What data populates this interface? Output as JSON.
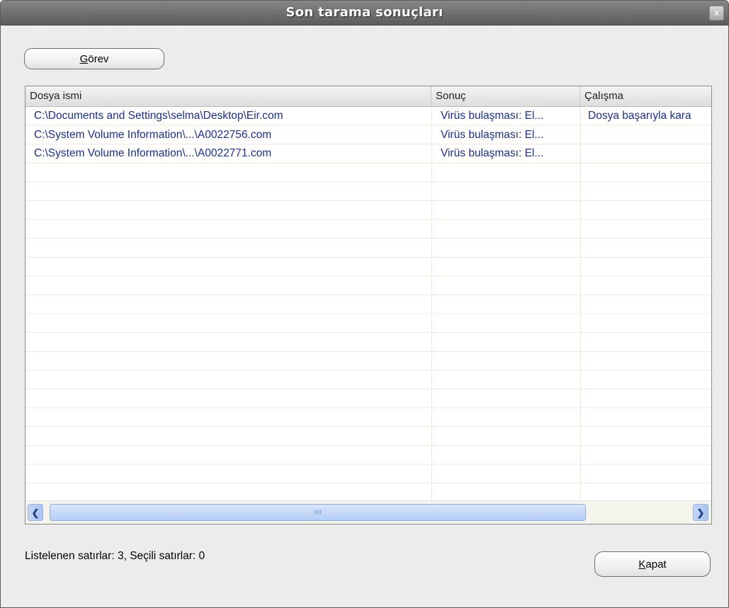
{
  "window": {
    "title": "Son tarama sonuçları",
    "close_icon": "close-icon"
  },
  "toolbar": {
    "task_label_first": "G",
    "task_label_rest": "örev"
  },
  "table": {
    "columns": [
      "Dosya ismi",
      "Sonuç",
      "Çalışma"
    ],
    "rows": [
      {
        "file": "C:\\Documents and Settings\\selma\\Desktop\\Eir.com",
        "result": "Virüs bulaşması: El...",
        "action": "Dosya başarıyla kara"
      },
      {
        "file": "C:\\System Volume Information\\...\\A0022756.com",
        "result": "Virüs bulaşması: El...",
        "action": ""
      },
      {
        "file": "C:\\System Volume Information\\...\\A0022771.com",
        "result": "Virüs bulaşması: El...",
        "action": ""
      }
    ]
  },
  "scrollbar": {
    "left_icon": "chevron-left-icon",
    "right_icon": "chevron-right-icon",
    "grip": "IIII"
  },
  "status": {
    "text": "Listelenen satırlar: 3,  Seçili satırlar: 0"
  },
  "footer": {
    "close_label_first": "K",
    "close_label_rest": "apat"
  },
  "colors": {
    "row_text": "#1a2e9e",
    "grid_line": "#ece9d8",
    "scroll_thumb": "#b6cdf5"
  }
}
